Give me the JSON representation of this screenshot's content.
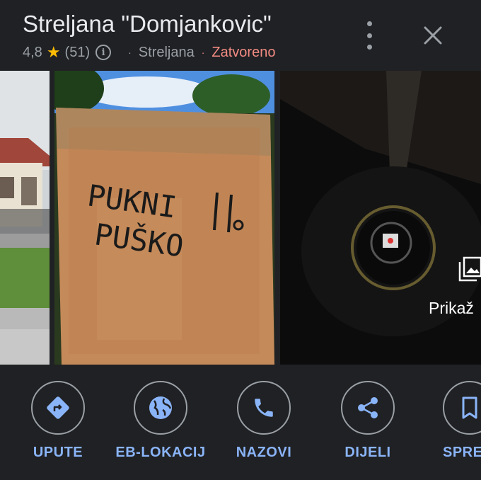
{
  "place": {
    "title": "Streljana \"Domjankovic\"",
    "rating": "4,8",
    "review_count": "(51)",
    "category": "Streljana",
    "status": "Zatvoreno",
    "separator": "·"
  },
  "gallery": {
    "see_all_label": "Prikaž",
    "graffiti_line1": "PUKNI",
    "graffiti_line2": "PUŠKO"
  },
  "actions": [
    {
      "label": "UPUTE",
      "icon": "directions-icon"
    },
    {
      "label": "EB-LOKACIJ",
      "icon": "globe-icon"
    },
    {
      "label": "NAZOVI",
      "icon": "phone-icon"
    },
    {
      "label": "DIJELI",
      "icon": "share-icon"
    },
    {
      "label": "SPRE",
      "icon": "bookmark-icon"
    }
  ],
  "colors": {
    "background": "#202124",
    "accent": "#8ab4f8",
    "star": "#fbbc04",
    "closed": "#f28b82",
    "muted": "#9aa0a6"
  }
}
